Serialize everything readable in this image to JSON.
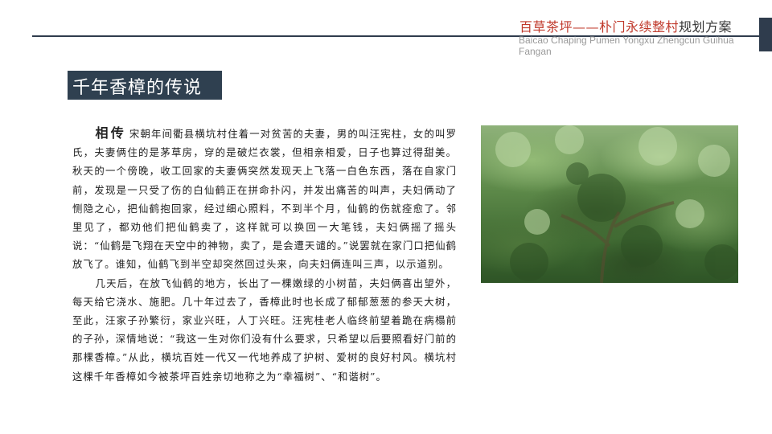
{
  "header": {
    "title_red": "百草茶坪——朴门永续整村",
    "title_dark": "规划方案",
    "subtitle_en": "Baicao Chaping Pumen Yongxu Zhengcun Guihua Fangan"
  },
  "section": {
    "title": "千年香樟的传说"
  },
  "article": {
    "lead": "相传",
    "paragraph_1": "宋朝年间衢县横坑村住着一对贫苦的夫妻，男的叫汪宪柱，女的叫罗氏，夫妻俩住的是茅草房，穿的是破烂衣裳，但相亲相爱，日子也算过得甜美。秋天的一个傍晚，收工回家的夫妻俩突然发现天上飞落一白色东西，落在自家门前，发现是一只受了伤的白仙鹤正在拼命扑闪，并发出痛苦的叫声，夫妇俩动了恻隐之心，把仙鹤抱回家，经过细心照料，不到半个月，仙鹤的伤就痊愈了。邻里见了，都劝他们把仙鹤卖了，这样就可以换回一大笔钱，夫妇俩摇了摇头说：“仙鹤是飞翔在天空中的神物，卖了，是会遭天谴的。”说罢就在家门口把仙鹤放飞了。谁知，仙鹤飞到半空却突然回过头来，向夫妇俩连叫三声，以示道别。",
    "paragraph_2": "几天后，在放飞仙鹤的地方，长出了一棵嫩绿的小树苗，夫妇俩喜出望外，每天给它浇水、施肥。几十年过去了，香樟此时也长成了郁郁葱葱的参天大树，至此，汪家子孙繁衍，家业兴旺，人丁兴旺。汪宪桂老人临终前望着跪在病榻前的子孙，深情地说：“我这一生对你们没有什么要求，只希望以后要照看好门前的那棵香樟。”从此，横坑百姓一代又一代地养成了护树、爱树的良好村风。横坑村这棵千年香樟如今被茶坪百姓亲切地称之为“幸福树”、“和谐树”。"
  },
  "photo": {
    "subject": "ancient-camphor-tree-canopy"
  },
  "colors": {
    "accent_red": "#c0392b",
    "navy": "#2f4050",
    "rule": "#2f3c4d"
  }
}
